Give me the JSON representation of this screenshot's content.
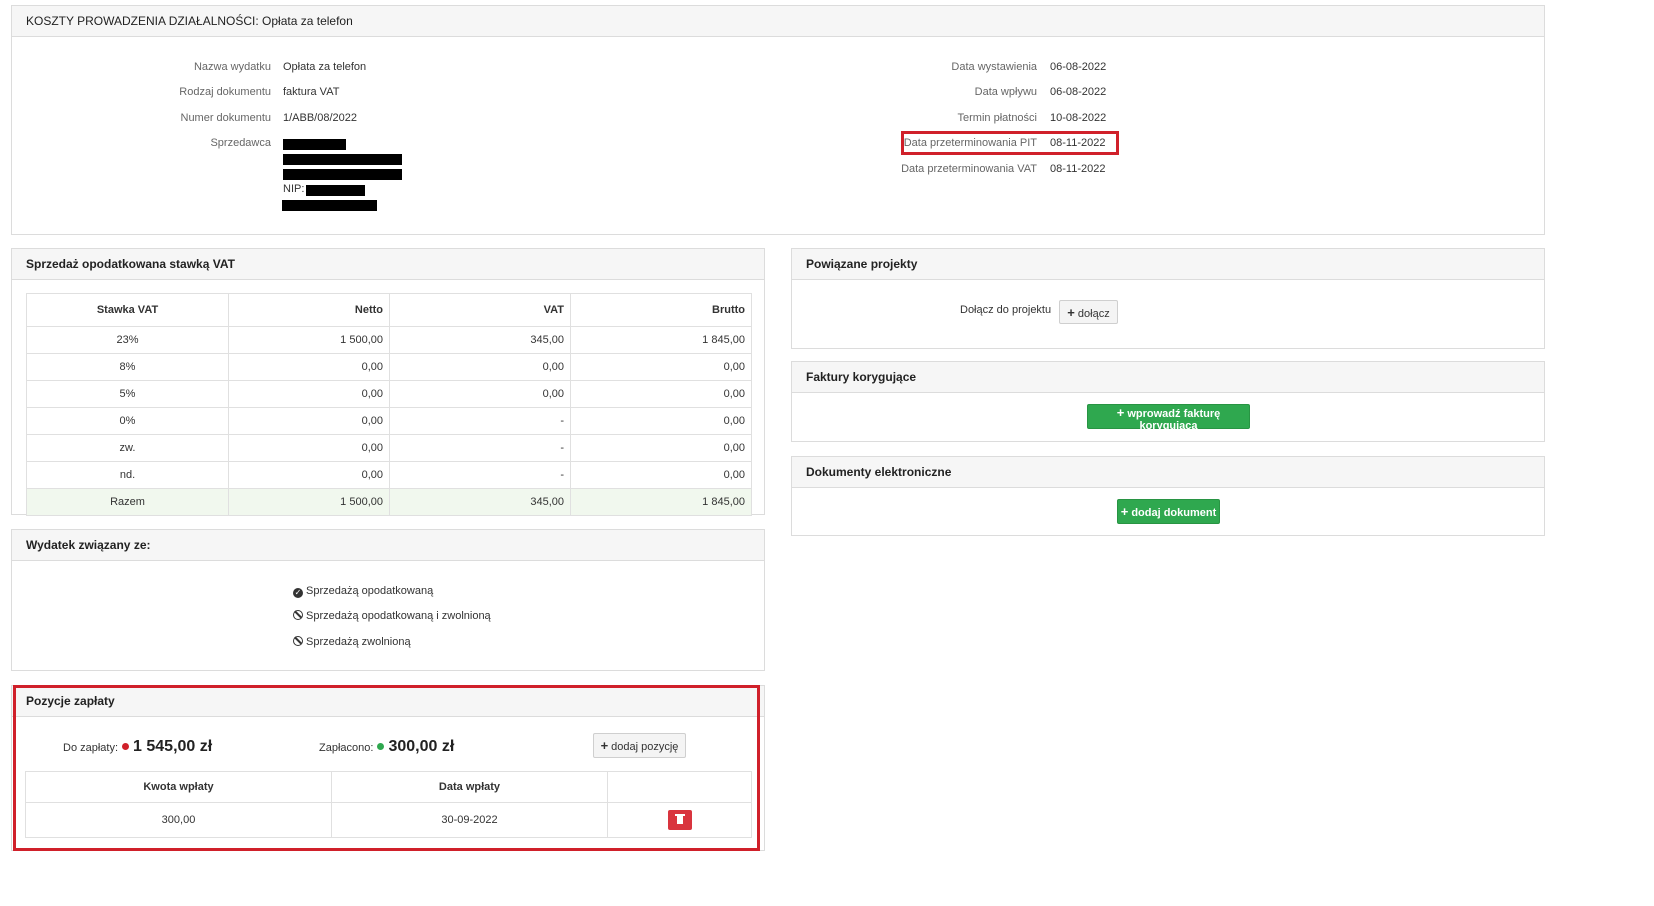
{
  "header": {
    "title": "KOSZTY PROWADZENIA DZIAŁALNOŚCI: Opłata za telefon"
  },
  "details_left": {
    "name_label": "Nazwa wydatku",
    "name_value": "Opłata za telefon",
    "doc_type_label": "Rodzaj dokumentu",
    "doc_type_value": "faktura VAT",
    "doc_number_label": "Numer dokumentu",
    "doc_number_value": "1/ABB/08/2022",
    "seller_label": "Sprzedawca",
    "seller_nip_prefix": "NIP:"
  },
  "details_right": {
    "issue_date_label": "Data wystawienia",
    "issue_date_value": "06-08-2022",
    "receipt_date_label": "Data wpływu",
    "receipt_date_value": "06-08-2022",
    "due_date_label": "Termin płatności",
    "due_date_value": "10-08-2022",
    "pit_overdue_label": "Data przeterminowania PIT",
    "pit_overdue_value": "08-11-2022",
    "vat_overdue_label": "Data przeterminowania VAT",
    "vat_overdue_value": "08-11-2022"
  },
  "vat_sales": {
    "title": "Sprzedaż opodatkowana stawką VAT",
    "columns": [
      "Stawka VAT",
      "Netto",
      "VAT",
      "Brutto"
    ],
    "rows": [
      [
        "23%",
        "1 500,00",
        "345,00",
        "1 845,00"
      ],
      [
        "8%",
        "0,00",
        "0,00",
        "0,00"
      ],
      [
        "5%",
        "0,00",
        "0,00",
        "0,00"
      ],
      [
        "0%",
        "0,00",
        "-",
        "0,00"
      ],
      [
        "zw.",
        "0,00",
        "-",
        "0,00"
      ],
      [
        "nd.",
        "0,00",
        "-",
        "0,00"
      ]
    ],
    "total": [
      "Razem",
      "1 500,00",
      "345,00",
      "1 845,00"
    ]
  },
  "related": {
    "title": "Wydatek związany ze:",
    "options": [
      {
        "label": "Sprzedażą opodatkowaną",
        "state": "checked"
      },
      {
        "label": "Sprzedażą opodatkowaną i zwolnioną",
        "state": "unchecked"
      },
      {
        "label": "Sprzedażą zwolnioną",
        "state": "unchecked"
      }
    ]
  },
  "payments": {
    "title": "Pozycje zapłaty",
    "to_pay_label": "Do zapłaty:",
    "to_pay_value": "1 545,00 zł",
    "paid_label": "Zapłacono:",
    "paid_value": "300,00 zł",
    "add_label": "dodaj pozycję",
    "columns": [
      "Kwota wpłaty",
      "Data wpłaty",
      ""
    ],
    "rows": [
      [
        "300,00",
        "30-09-2022"
      ]
    ],
    "colors": {
      "due": "#d0202a",
      "paid": "#2fa84f"
    }
  },
  "projects": {
    "title": "Powiązane projekty",
    "join_label": "Dołącz do projektu",
    "join_button": "dołącz"
  },
  "corrections": {
    "title": "Faktury korygujące",
    "button": "wprowadź fakturę korygującą"
  },
  "edocs": {
    "title": "Dokumenty elektroniczne",
    "button": "dodaj dokument"
  },
  "highlight_color": "#d0202a"
}
